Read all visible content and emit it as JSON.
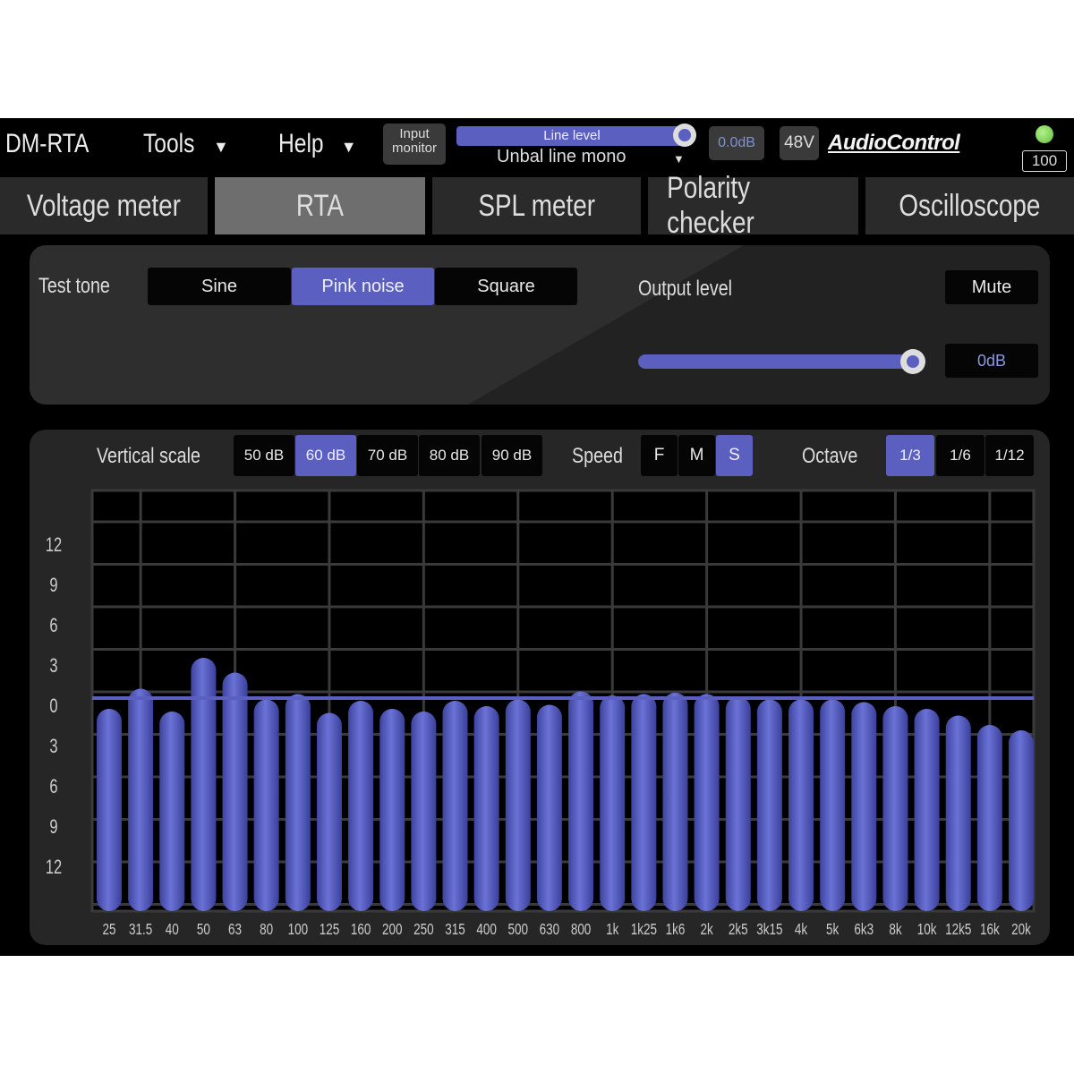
{
  "header": {
    "app_title": "DM-RTA",
    "menus": [
      {
        "label": "Tools",
        "icon": "caret-down-icon"
      },
      {
        "label": "Help",
        "icon": "caret-down-icon"
      }
    ],
    "input_monitor": {
      "line1": "Input",
      "line2": "monitor"
    },
    "input_level": {
      "label": "Line level",
      "slider_fraction": 1.0
    },
    "input_mode": "Unbal line mono",
    "gain_readout": "0.0dB",
    "phantom_label": "48V",
    "brand": "AudioControl",
    "battery": "100",
    "status_led_color": "#7ed957"
  },
  "tabs": [
    {
      "label": "Voltage meter",
      "active": false
    },
    {
      "label": "RTA",
      "active": true
    },
    {
      "label": "SPL meter",
      "active": false
    },
    {
      "label": "Polarity checker",
      "active": false
    },
    {
      "label": "Oscilloscope",
      "active": false
    }
  ],
  "test_tone": {
    "label": "Test tone",
    "options": [
      {
        "label": "Sine",
        "active": false
      },
      {
        "label": "Pink noise",
        "active": true
      },
      {
        "label": "Square",
        "active": false
      }
    ],
    "output_level_label": "Output level",
    "mute_label": "Mute",
    "output_level_value": "0dB",
    "output_slider_fraction": 1.0
  },
  "rta_controls": {
    "vertical_scale_label": "Vertical scale",
    "vertical_scale_options": [
      {
        "label": "50 dB",
        "active": false
      },
      {
        "label": "60 dB",
        "active": true
      },
      {
        "label": "70 dB",
        "active": false
      },
      {
        "label": "80 dB",
        "active": false
      },
      {
        "label": "90 dB",
        "active": false
      }
    ],
    "speed_label": "Speed",
    "speed_options": [
      {
        "label": "F",
        "active": false
      },
      {
        "label": "M",
        "active": false
      },
      {
        "label": "S",
        "active": true
      }
    ],
    "octave_label": "Octave",
    "octave_options": [
      {
        "label": "1/3",
        "active": true
      },
      {
        "label": "1/6",
        "active": false
      },
      {
        "label": "1/12",
        "active": false
      }
    ]
  },
  "colors": {
    "accent": "#5a5fc0",
    "bar": "#5b62c4",
    "panel": "#262626"
  },
  "chart_data": {
    "type": "bar",
    "categories": [
      "25",
      "31.5",
      "40",
      "50",
      "63",
      "80",
      "100",
      "125",
      "160",
      "200",
      "250",
      "315",
      "400",
      "500",
      "630",
      "800",
      "1k",
      "1k25",
      "1k6",
      "2k",
      "2k5",
      "3k15",
      "4k",
      "5k",
      "6k3",
      "8k",
      "10k",
      "12k5",
      "16k",
      "20k"
    ],
    "values": [
      -0.8,
      0.7,
      -1.0,
      3.0,
      1.9,
      -0.1,
      0.3,
      -1.1,
      -0.2,
      -0.8,
      -1.0,
      -0.2,
      -0.6,
      -0.1,
      -0.5,
      0.5,
      0.2,
      0.3,
      0.4,
      0.3,
      0.1,
      -0.1,
      -0.1,
      -0.1,
      -0.3,
      -0.6,
      -0.8,
      -1.3,
      -2.0,
      -2.4
    ],
    "y_tick_labels": [
      "12",
      "9",
      "6",
      "3",
      "0",
      "3",
      "6",
      "9",
      "12"
    ],
    "y_tick_values": [
      12,
      9,
      6,
      3,
      0,
      -3,
      -6,
      -9,
      -12
    ],
    "reference_line": 0,
    "grid": true,
    "xlabel": "",
    "ylabel": ""
  }
}
